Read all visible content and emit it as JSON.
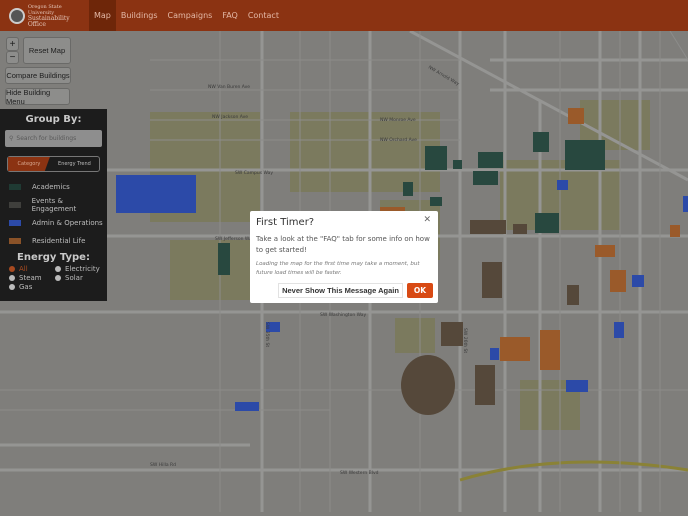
{
  "header": {
    "logo_line1": "Oregon State University",
    "logo_line2": "Sustainability Office",
    "nav": [
      {
        "label": "Map",
        "active": true
      },
      {
        "label": "Buildings"
      },
      {
        "label": "Campaigns"
      },
      {
        "label": "FAQ"
      },
      {
        "label": "Contact"
      }
    ]
  },
  "map_controls": {
    "zoom_in": "+",
    "zoom_out": "−",
    "reset": "Reset Map",
    "compare": "Compare Buildings",
    "hide_menu": "Hide Building Menu"
  },
  "panel": {
    "group_title": "Group By:",
    "search_placeholder": "Search for buildings",
    "toggle": [
      "Category",
      "Energy Trend"
    ],
    "categories": [
      {
        "label": "Academics",
        "color": "#1f4a40"
      },
      {
        "label": "Events & Engagement",
        "color": "#4a4a44"
      },
      {
        "label": "Admin & Operations",
        "color": "#2c4aa8"
      },
      {
        "label": "Residential Life",
        "color": "#9a5a2a"
      }
    ],
    "energy_title": "Energy Type:",
    "energy_types": [
      {
        "label": "All",
        "selected": true
      },
      {
        "label": "Electricity"
      },
      {
        "label": "Steam"
      },
      {
        "label": "Solar"
      },
      {
        "label": "Gas"
      }
    ]
  },
  "streets": [
    "NW Van Buren Ave",
    "NW Jackson Ave",
    "NW Orchard Ave",
    "SW Campus Way",
    "SW Jefferson Way",
    "SW Washington Way",
    "SW Western Blvd",
    "SW Hilla Rd",
    "NW Monroe Ave",
    "SW 35th St",
    "SW 26th St",
    "NW Arnold Way"
  ],
  "modal": {
    "title": "First Timer?",
    "message": "Take a look at the \"FAQ\" tab for some info on how to get started!",
    "note": "Loading the map for the first time may take a moment, but future load times will be faster.",
    "never_button": "Never Show This Message Again",
    "ok_button": "OK"
  },
  "accent": "#d84a14"
}
